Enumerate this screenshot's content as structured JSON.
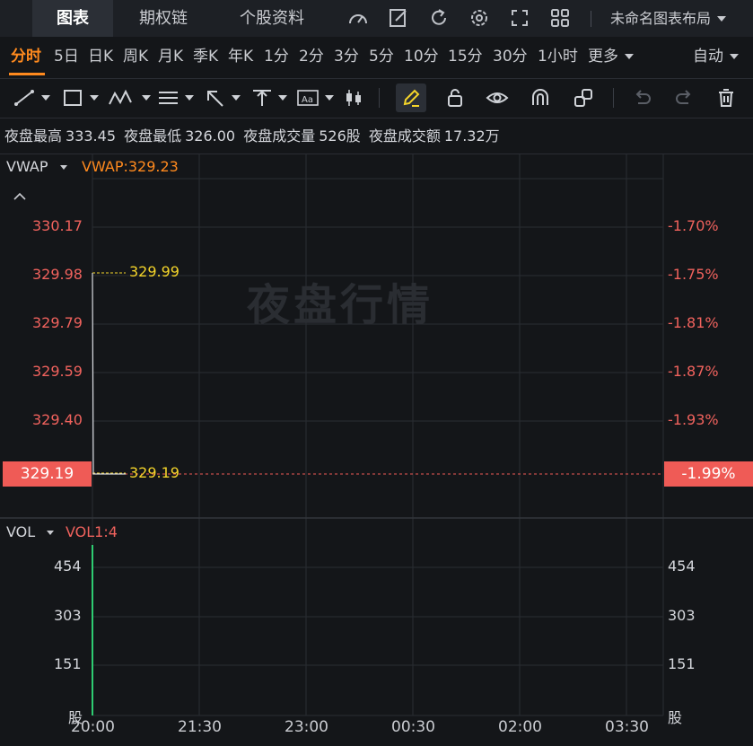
{
  "top_tabs": [
    {
      "label": "图表",
      "active": true
    },
    {
      "label": "期权链",
      "active": false
    },
    {
      "label": "个股资料",
      "active": false
    }
  ],
  "layout_name": "未命名图表布局",
  "periods": [
    "分时",
    "5日",
    "日K",
    "周K",
    "月K",
    "季K",
    "年K",
    "1分",
    "2分",
    "3分",
    "5分",
    "10分",
    "15分",
    "30分",
    "1小时",
    "更多"
  ],
  "active_period": "分时",
  "auto_label": "自动",
  "info": {
    "high_label": "夜盘最高",
    "high_value": "333.45",
    "low_label": "夜盘最低",
    "low_value": "326.00",
    "volume_label": "夜盘成交量",
    "volume_value": "526股",
    "turnover_label": "夜盘成交额",
    "turnover_value": "17.32万"
  },
  "main_indicator": {
    "name": "VWAP",
    "value_text": "VWAP:329.23"
  },
  "watermark": "夜盘行情",
  "price_axis_left": [
    "330.17",
    "329.98",
    "329.79",
    "329.59",
    "329.40"
  ],
  "price_axis_right": [
    "-1.70%",
    "-1.75%",
    "-1.81%",
    "-1.87%",
    "-1.93%"
  ],
  "current_price_badge": "329.19",
  "current_pct_badge": "-1.99%",
  "price_markers": {
    "high": "329.99",
    "low": "329.19"
  },
  "vol_indicator": {
    "name": "VOL",
    "value_text": "VOL1:4"
  },
  "vol_axis_left": [
    "454",
    "303",
    "151",
    "股"
  ],
  "vol_axis_right": [
    "454",
    "303",
    "151",
    "股"
  ],
  "time_axis": [
    "20:00",
    "21:30",
    "23:00",
    "00:30",
    "02:00",
    "03:30"
  ],
  "colors": {
    "accent": "#ff8a1e",
    "down": "#ef5b56",
    "up": "#2ecc71",
    "marker": "#f5d52a",
    "background": "#141619"
  }
}
